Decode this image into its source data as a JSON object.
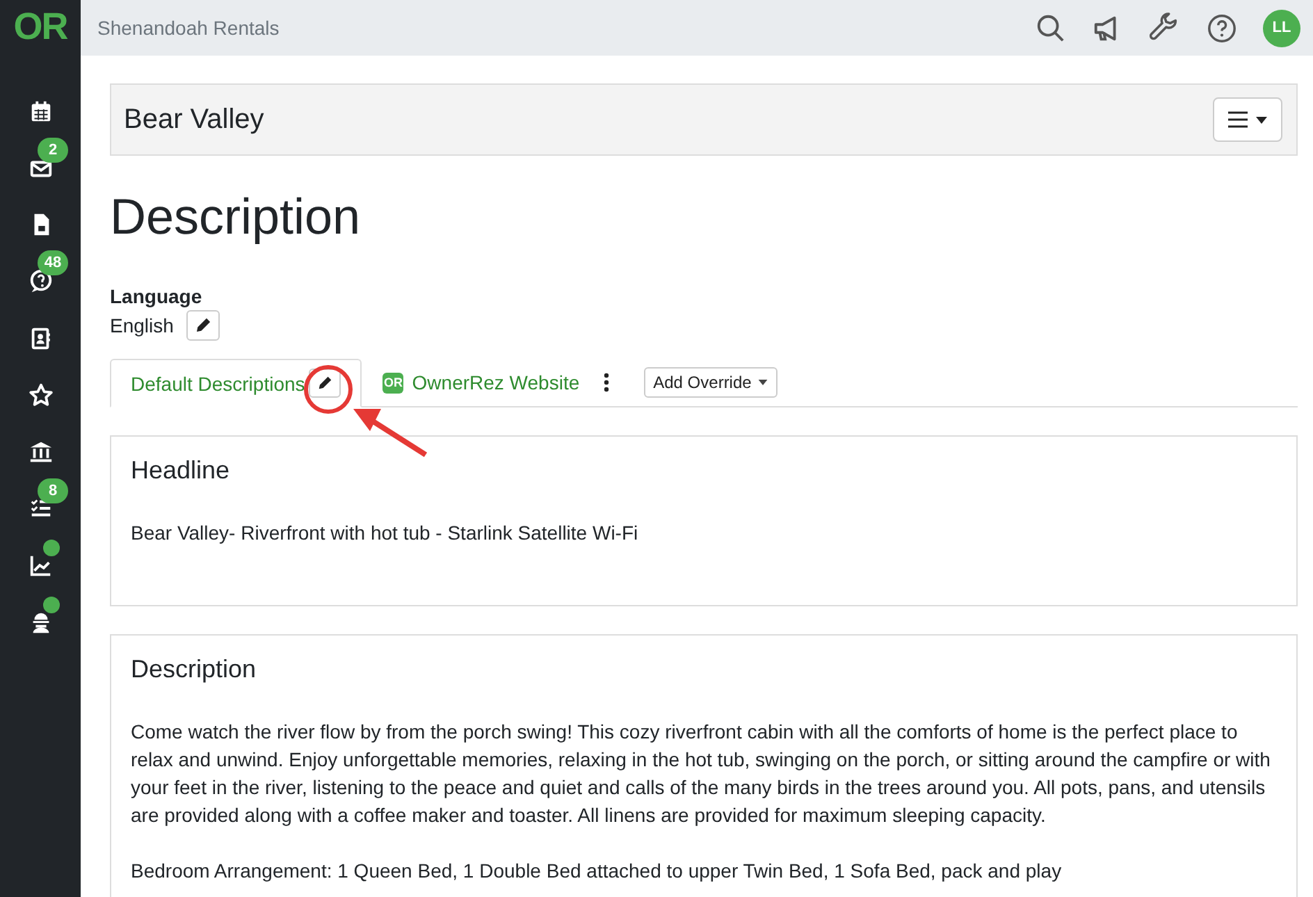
{
  "logo": "OR",
  "topbar": {
    "org_name": "Shenandoah Rentals",
    "avatar": "LL"
  },
  "sidebar": {
    "items": [
      {
        "dot": false
      },
      {
        "badge": "2",
        "dot": false
      },
      {
        "dot": false
      },
      {
        "badge": "48",
        "dot": false
      },
      {
        "dot": false
      },
      {
        "dot": false
      },
      {
        "dot": false
      },
      {
        "badge": "8",
        "dot": false
      },
      {
        "dot": true
      },
      {
        "dot": true
      }
    ]
  },
  "property": {
    "name": "Bear Valley"
  },
  "page_title": "Description",
  "language": {
    "label": "Language",
    "value": "English"
  },
  "tabs": [
    {
      "label": "Default Descriptions",
      "selected": true,
      "kind": "editable"
    },
    {
      "label": "OwnerRez Website",
      "selected": false,
      "kind": "channel",
      "logo": "OR"
    }
  ],
  "add_override": "Add Override",
  "sections": [
    {
      "title": "Headline",
      "paragraphs": [
        "Bear Valley- Riverfront with hot tub - Starlink Satellite Wi-Fi"
      ]
    },
    {
      "title": "Description",
      "paragraphs": [
        "Come watch the river flow by from the porch swing! This cozy riverfront cabin with all the comforts of home is the perfect place to relax and unwind. Enjoy unforgettable memories, relaxing in the hot tub, swinging on the porch, or sitting around the campfire or with your feet in the river, listening to the peace and quiet and calls of the many birds in the trees around you. All pots, pans, and utensils are provided along with a coffee maker and toaster. All linens are provided for maximum sleeping capacity.",
        "Bedroom Arrangement: 1 Queen Bed, 1 Double Bed attached to upper Twin Bed, 1 Sofa Bed, pack and play"
      ]
    }
  ]
}
